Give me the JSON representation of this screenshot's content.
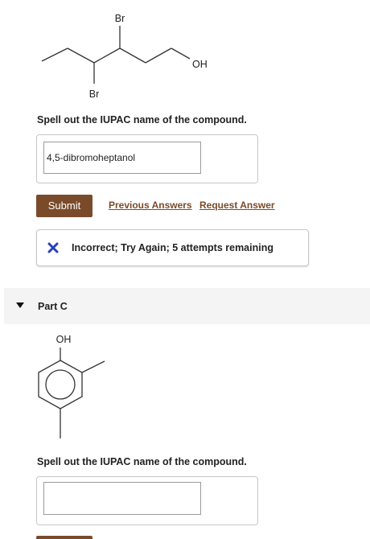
{
  "part_b": {
    "structure_labels": {
      "br_top": "Br",
      "br_bottom": "Br",
      "oh": "OH"
    },
    "question": "Spell out the IUPAC name of the compound.",
    "answer_value": "4,5-dibromoheptanol",
    "submit_label": "Submit",
    "previous_answers_label": "Previous Answers",
    "request_answer_label": "Request Answer",
    "feedback_text": "Incorrect; Try Again; 5 attempts remaining"
  },
  "part_c": {
    "title": "Part C",
    "structure_labels": {
      "oh": "OH"
    },
    "question": "Spell out the IUPAC name of the compound.",
    "answer_value": ""
  },
  "colors": {
    "accent_brown": "#7a4b2a",
    "incorrect_x": "#2a3fb8",
    "part_header_bg": "#f4f4f4"
  },
  "icons": {
    "feedback_icon": "incorrect-x-icon",
    "part_toggle_icon": "caret-down-icon"
  }
}
